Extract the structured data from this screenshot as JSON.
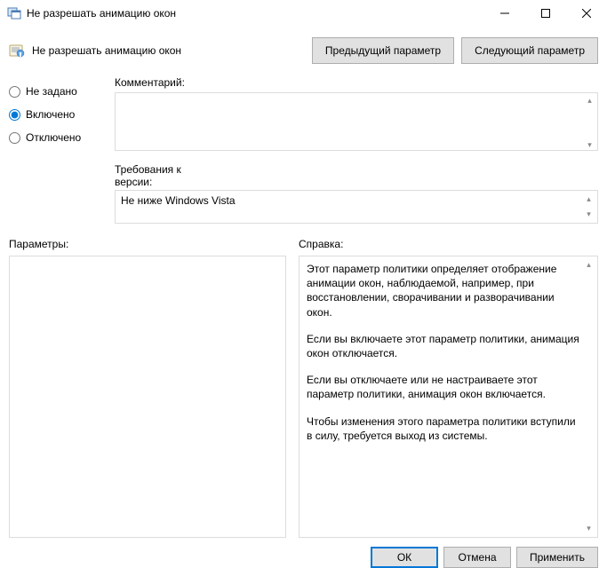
{
  "window": {
    "title": "Не разрешать анимацию окон"
  },
  "header": {
    "policy_title": "Не разрешать анимацию окон",
    "prev_btn": "Предыдущий параметр",
    "next_btn": "Следующий параметр"
  },
  "state": {
    "not_configured": "Не задано",
    "enabled": "Включено",
    "disabled": "Отключено",
    "selected": "enabled"
  },
  "fields": {
    "comment_label": "Комментарий:",
    "comment_value": "",
    "version_label": "Требования к версии:",
    "version_value": "Не ниже Windows Vista"
  },
  "panels": {
    "params_label": "Параметры:",
    "help_label": "Справка:",
    "help_p1": "Этот параметр политики определяет отображение анимации окон, наблюдаемой, например, при восстановлении, сворачивании и разворачивании окон.",
    "help_p2": "Если вы включаете этот параметр политики, анимация окон отключается.",
    "help_p3": "Если вы отключаете или не настраиваете этот параметр политики, анимация окон включается.",
    "help_p4": "Чтобы изменения этого параметра политики вступили в силу, требуется выход из системы."
  },
  "footer": {
    "ok": "ОК",
    "cancel": "Отмена",
    "apply": "Применить"
  }
}
